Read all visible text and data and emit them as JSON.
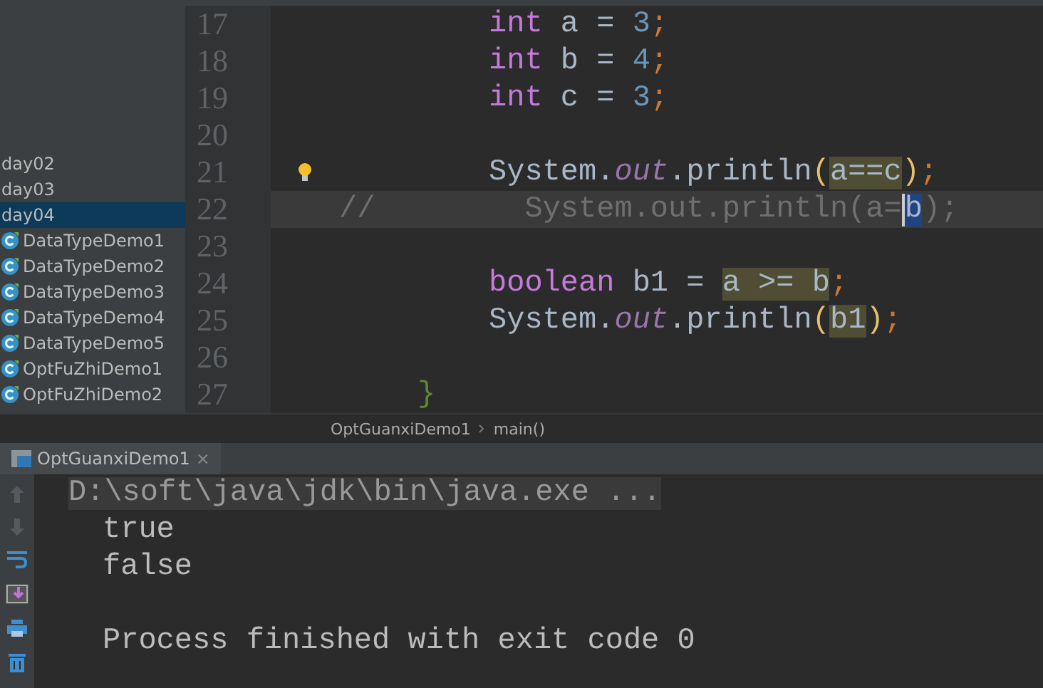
{
  "project_tree": {
    "items": [
      {
        "label": "day02",
        "kind": "folder",
        "selected": false
      },
      {
        "label": "day03",
        "kind": "folder",
        "selected": false
      },
      {
        "label": "day04",
        "kind": "folder",
        "selected": true
      },
      {
        "label": "DataTypeDemo1",
        "kind": "class",
        "selected": false
      },
      {
        "label": "DataTypeDemo2",
        "kind": "class",
        "selected": false
      },
      {
        "label": "DataTypeDemo3",
        "kind": "class",
        "selected": false
      },
      {
        "label": "DataTypeDemo4",
        "kind": "class",
        "selected": false
      },
      {
        "label": "DataTypeDemo5",
        "kind": "class",
        "selected": false
      },
      {
        "label": "OptFuZhiDemo1",
        "kind": "class",
        "selected": false
      },
      {
        "label": "OptFuZhiDemo2",
        "kind": "class",
        "selected": false
      }
    ]
  },
  "editor": {
    "lines": [
      {
        "number": "17",
        "kind": "code",
        "current": false,
        "tokens": [
          {
            "t": "int",
            "kind": "kw"
          },
          {
            "t": "a =",
            "kind": "text"
          },
          {
            "t": "3",
            "kind": "number"
          },
          {
            "t": ";",
            "kind": "semi"
          }
        ]
      },
      {
        "number": "18",
        "kind": "code",
        "current": false,
        "tokens": [
          {
            "t": "int",
            "kind": "kw"
          },
          {
            "t": "b =",
            "kind": "text"
          },
          {
            "t": "4",
            "kind": "number"
          },
          {
            "t": ";",
            "kind": "semi"
          }
        ]
      },
      {
        "number": "19",
        "kind": "code",
        "current": false,
        "tokens": [
          {
            "t": "int",
            "kind": "kw"
          },
          {
            "t": "c =",
            "kind": "text"
          },
          {
            "t": "3",
            "kind": "number"
          },
          {
            "t": ";",
            "kind": "semi"
          }
        ]
      },
      {
        "number": "20",
        "kind": "blank",
        "current": false
      },
      {
        "number": "21",
        "kind": "code",
        "current": false,
        "bulb": true,
        "tokens": [
          {
            "t": "System.",
            "kind": "text"
          },
          {
            "t": "out",
            "kind": "field"
          },
          {
            "t": ".println",
            "kind": "text"
          },
          {
            "t": "(",
            "kind": "paren"
          },
          {
            "t": "a==c",
            "kind": "hl"
          },
          {
            "t": ")",
            "kind": "paren"
          },
          {
            "t": ";",
            "kind": "semi"
          }
        ]
      },
      {
        "number": "22",
        "kind": "commented",
        "current": true,
        "marker": "//",
        "tokens": [
          {
            "t": "System.out.println(a=",
            "kind": "comment"
          },
          {
            "t": "b",
            "kind": "sel"
          },
          {
            "t": ");",
            "kind": "comment"
          }
        ]
      },
      {
        "number": "23",
        "kind": "blank",
        "current": false
      },
      {
        "number": "24",
        "kind": "code",
        "current": false,
        "tokens": [
          {
            "t": "boolean",
            "kind": "kw"
          },
          {
            "t": "b1 =",
            "kind": "text"
          },
          {
            "t": "a >= b",
            "kind": "hl"
          },
          {
            "t": ";",
            "kind": "semi"
          }
        ]
      },
      {
        "number": "25",
        "kind": "code",
        "current": false,
        "tokens": [
          {
            "t": "System.",
            "kind": "text"
          },
          {
            "t": "out",
            "kind": "field"
          },
          {
            "t": ".println",
            "kind": "text"
          },
          {
            "t": "(",
            "kind": "paren"
          },
          {
            "t": "b1",
            "kind": "hl"
          },
          {
            "t": ")",
            "kind": "paren"
          },
          {
            "t": ";",
            "kind": "semi"
          }
        ]
      },
      {
        "number": "26",
        "kind": "blank",
        "current": false
      },
      {
        "number": "27",
        "kind": "closing",
        "current": false,
        "tokens": [
          {
            "t": "}",
            "kind": "brace"
          }
        ]
      }
    ]
  },
  "breadcrumbs": [
    "OptGuanxiDemo1",
    "main()"
  ],
  "run_panel": {
    "tab": {
      "label": "OptGuanxiDemo1",
      "close": "×"
    },
    "output": [
      {
        "text": "D:\\soft\\java\\jdk\\bin\\java.exe ...",
        "kind": "command"
      },
      {
        "text": "true",
        "kind": "out"
      },
      {
        "text": "false",
        "kind": "out"
      },
      {
        "kind": "blank"
      },
      {
        "text": "Process finished with exit code 0",
        "kind": "out"
      }
    ]
  }
}
